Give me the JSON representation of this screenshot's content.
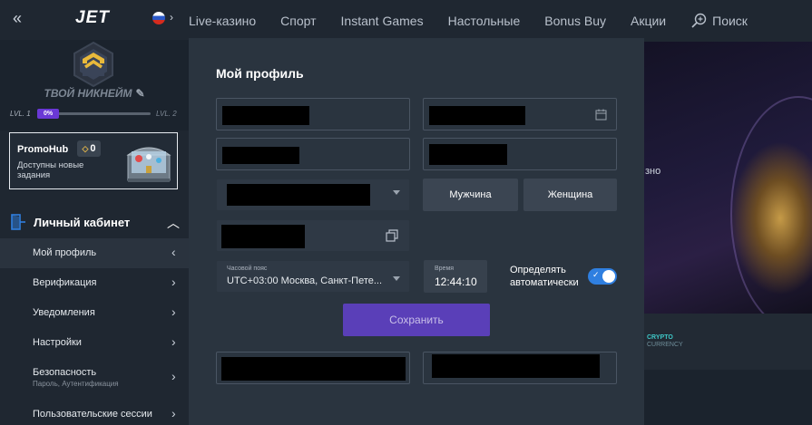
{
  "topnav": {
    "items": [
      "Live-казино",
      "Спорт",
      "Instant Games",
      "Настольные",
      "Bonus Buy",
      "Акции"
    ],
    "search_label": "Поиск"
  },
  "sidebar": {
    "collapse_icon": "double-chevron-left-icon",
    "logo": "JET",
    "language_flag": "russia-flag-icon",
    "nickname": "ТВОЙ НИКНЕЙМ",
    "level_current": "LVL. 1",
    "level_next": "LVL. 2",
    "level_progress": "0%",
    "level_progress_value": 0,
    "promo": {
      "title": "PromoHub",
      "count": "0",
      "description": "Доступны новые задания"
    },
    "cabinet_label": "Личный кабинет",
    "menu": [
      {
        "label": "Мой профиль",
        "sub": ""
      },
      {
        "label": "Верификация",
        "sub": ""
      },
      {
        "label": "Уведомления",
        "sub": ""
      },
      {
        "label": "Настройки",
        "sub": ""
      },
      {
        "label": "Безопасность",
        "sub": "Пароль, Аутентификация"
      },
      {
        "label": "Пользовательские сессии",
        "sub": ""
      }
    ]
  },
  "modal": {
    "title": "Мой профиль",
    "gender_male": "Мужчина",
    "gender_female": "Женщина",
    "timezone_label": "Часовой пояс",
    "timezone_value": "UTC+03:00 Москва, Санкт-Пете...",
    "time_label": "Время",
    "time_value": "12:44:10",
    "auto_detect_label": "Определять автоматически",
    "auto_detect_on": true,
    "save_label": "Сохранить"
  },
  "background": {
    "partial_text": "зно",
    "crypto_title": "CRYPTO",
    "crypto_sub": "CURRENCY"
  },
  "colors": {
    "accent_purple": "#5a3fb8",
    "toggle_blue": "#2f7fe0",
    "sidebar_bg": "#1f2731",
    "modal_bg": "#2a343f"
  }
}
